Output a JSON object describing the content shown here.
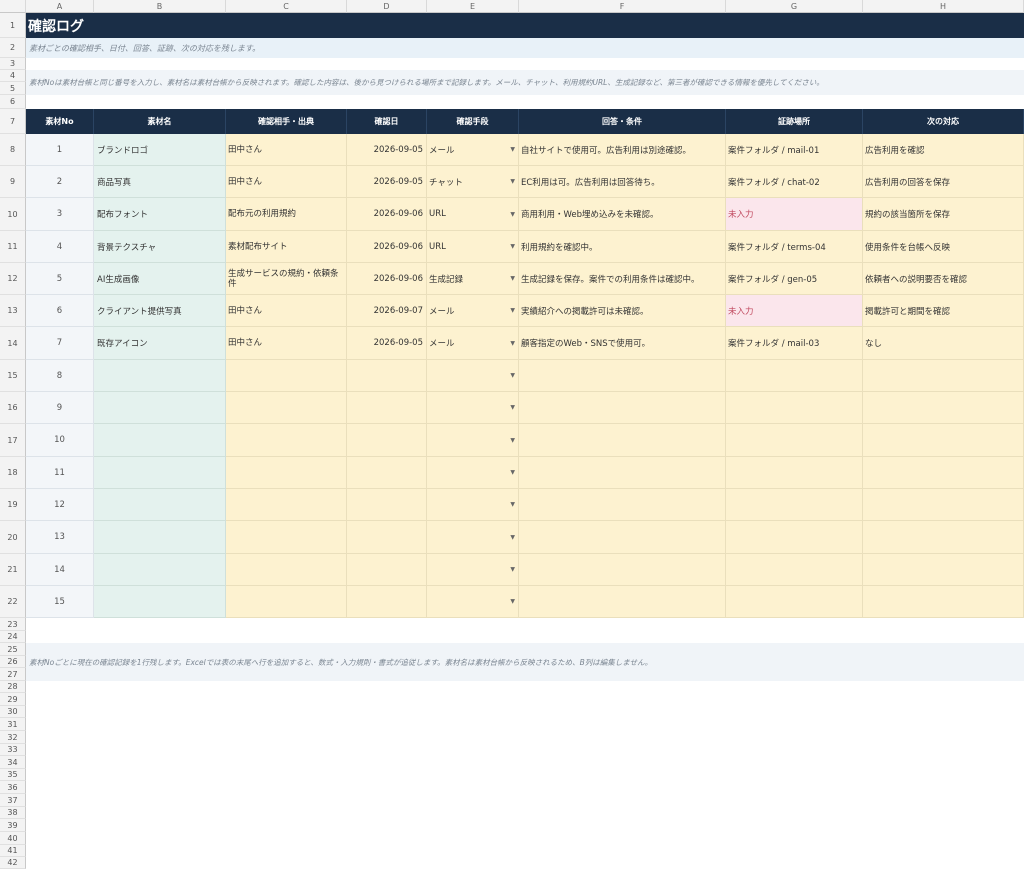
{
  "columns": [
    "A",
    "B",
    "C",
    "D",
    "E",
    "F",
    "G",
    "H"
  ],
  "title": "確認ログ",
  "subtitle": "素材ごとの確認相手、日付、回答、証跡、次の対応を残します。",
  "instructions": "素材Noは素材台帳と同じ番号を入力し、素材名は素材台帳から反映されます。確認した内容は、後から見つけられる場所まで記録します。メール、チャット、利用規約URL、生成記録など、第三者が確認できる情報を優先してください。",
  "headers": [
    "素材No",
    "素材名",
    "確認相手・出典",
    "確認日",
    "確認手段",
    "回答・条件",
    "証跡場所",
    "次の対応"
  ],
  "rows": [
    {
      "no": "1",
      "name": "ブランドロゴ",
      "contact": "田中さん",
      "date": "2026-09-05",
      "method": "メール",
      "answer": "自社サイトで使用可。広告利用は別途確認。",
      "evidence": "案件フォルダ / mail-01",
      "next": "広告利用を確認"
    },
    {
      "no": "2",
      "name": "商品写真",
      "contact": "田中さん",
      "date": "2026-09-05",
      "method": "チャット",
      "answer": "EC利用は可。広告利用は回答待ち。",
      "evidence": "案件フォルダ / chat-02",
      "next": "広告利用の回答を保存"
    },
    {
      "no": "3",
      "name": "配布フォント",
      "contact": "配布元の利用規約",
      "date": "2026-09-06",
      "method": "URL",
      "answer": "商用利用・Web埋め込みを未確認。",
      "evidence": "未入力",
      "next": "規約の該当箇所を保存"
    },
    {
      "no": "4",
      "name": "背景テクスチャ",
      "contact": "素材配布サイト",
      "date": "2026-09-06",
      "method": "URL",
      "answer": "利用規約を確認中。",
      "evidence": "案件フォルダ / terms-04",
      "next": "使用条件を台帳へ反映"
    },
    {
      "no": "5",
      "name": "AI生成画像",
      "contact": "生成サービスの規約・依頼条件",
      "date": "2026-09-06",
      "method": "生成記録",
      "answer": "生成記録を保存。案件での利用条件は確認中。",
      "evidence": "案件フォルダ / gen-05",
      "next": "依頼者への説明要否を確認"
    },
    {
      "no": "6",
      "name": "クライアント提供写真",
      "contact": "田中さん",
      "date": "2026-09-07",
      "method": "メール",
      "answer": "実績紹介への掲載許可は未確認。",
      "evidence": "未入力",
      "next": "掲載許可と期間を確認"
    },
    {
      "no": "7",
      "name": "既存アイコン",
      "contact": "田中さん",
      "date": "2026-09-05",
      "method": "メール",
      "answer": "顧客指定のWeb・SNSで使用可。",
      "evidence": "案件フォルダ / mail-03",
      "next": "なし"
    },
    {
      "no": "8",
      "name": "",
      "contact": "",
      "date": "",
      "method": "",
      "answer": "",
      "evidence": "",
      "next": ""
    },
    {
      "no": "9",
      "name": "",
      "contact": "",
      "date": "",
      "method": "",
      "answer": "",
      "evidence": "",
      "next": ""
    },
    {
      "no": "10",
      "name": "",
      "contact": "",
      "date": "",
      "method": "",
      "answer": "",
      "evidence": "",
      "next": ""
    },
    {
      "no": "11",
      "name": "",
      "contact": "",
      "date": "",
      "method": "",
      "answer": "",
      "evidence": "",
      "next": ""
    },
    {
      "no": "12",
      "name": "",
      "contact": "",
      "date": "",
      "method": "",
      "answer": "",
      "evidence": "",
      "next": ""
    },
    {
      "no": "13",
      "name": "",
      "contact": "",
      "date": "",
      "method": "",
      "answer": "",
      "evidence": "",
      "next": ""
    },
    {
      "no": "14",
      "name": "",
      "contact": "",
      "date": "",
      "method": "",
      "answer": "",
      "evidence": "",
      "next": ""
    },
    {
      "no": "15",
      "name": "",
      "contact": "",
      "date": "",
      "method": "",
      "answer": "",
      "evidence": "",
      "next": ""
    }
  ],
  "footer_note": "素材Noごとに現在の確認記録を1行残します。Excelでは表の末尾へ行を追加すると、数式・入力規則・書式が追従します。素材名は素材台帳から反映されるため、B列は編集しません。",
  "row_numbers": [
    "1",
    "2",
    "3",
    "4",
    "5",
    "6",
    "7",
    "8",
    "9",
    "10",
    "11",
    "12",
    "13",
    "14",
    "15",
    "16",
    "17",
    "18",
    "19",
    "20",
    "21",
    "22",
    "23",
    "24",
    "25",
    "26",
    "27",
    "28",
    "29",
    "30",
    "31",
    "32",
    "33",
    "34",
    "35",
    "36",
    "37",
    "38",
    "39",
    "40",
    "41",
    "42"
  ],
  "dropdown_icon": "triangle-down-icon",
  "missing_value_color": "#c0475d"
}
